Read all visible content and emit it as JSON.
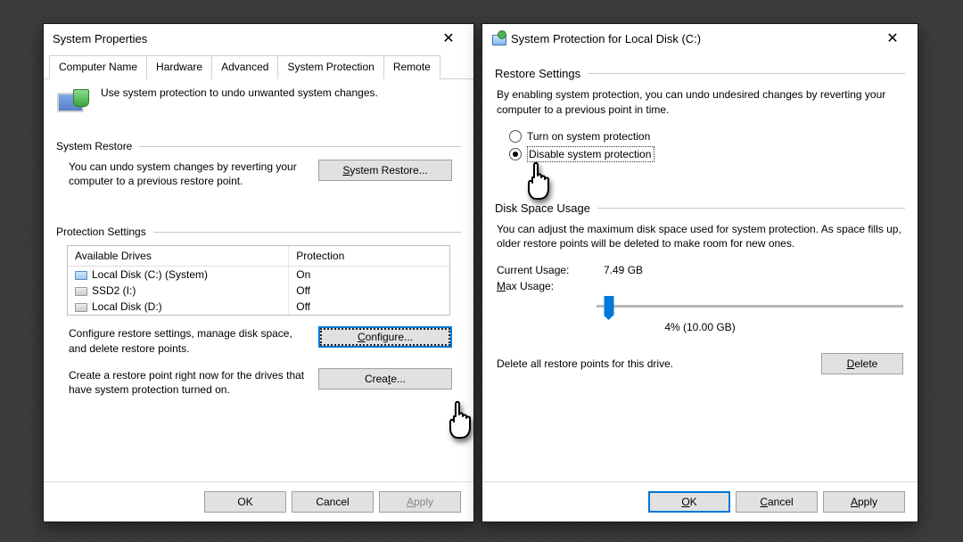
{
  "left": {
    "title": "System Properties",
    "tabs": [
      "Computer Name",
      "Hardware",
      "Advanced",
      "System Protection",
      "Remote"
    ],
    "active_tab": 3,
    "intro": "Use system protection to undo unwanted system changes.",
    "section_restore": "System Restore",
    "restore_text": "You can undo system changes by reverting your computer to a previous restore point.",
    "restore_btn": "System Restore...",
    "section_protection": "Protection Settings",
    "col_drives": "Available Drives",
    "col_protection": "Protection",
    "drives": [
      {
        "name": "Local Disk (C:) (System)",
        "protection": "On",
        "color": "blue"
      },
      {
        "name": "SSD2 (I:)",
        "protection": "Off",
        "color": "grey"
      },
      {
        "name": "Local Disk (D:)",
        "protection": "Off",
        "color": "grey"
      }
    ],
    "configure_text": "Configure restore settings, manage disk space, and delete restore points.",
    "configure_btn": "Configure...",
    "create_text": "Create a restore point right now for the drives that have system protection turned on.",
    "create_btn": "Create...",
    "ok": "OK",
    "cancel": "Cancel",
    "apply": "Apply"
  },
  "right": {
    "title": "System Protection for Local Disk (C:)",
    "section_restore": "Restore Settings",
    "restore_desc": "By enabling system protection, you can undo undesired changes by reverting your computer to a previous point in time.",
    "radio_on": "Turn on system protection",
    "radio_off": "Disable system protection",
    "section_disk": "Disk Space Usage",
    "disk_desc": "You can adjust the maximum disk space used for system protection. As space fills up, older restore points will be deleted to make room for new ones.",
    "current_label": "Current Usage:",
    "current_value": "7.49 GB",
    "max_label": "Max Usage:",
    "slider_pct": 4,
    "slider_text": "4% (10.00 GB)",
    "delete_text": "Delete all restore points for this drive.",
    "delete_btn": "Delete",
    "ok": "OK",
    "cancel": "Cancel",
    "apply": "Apply"
  }
}
